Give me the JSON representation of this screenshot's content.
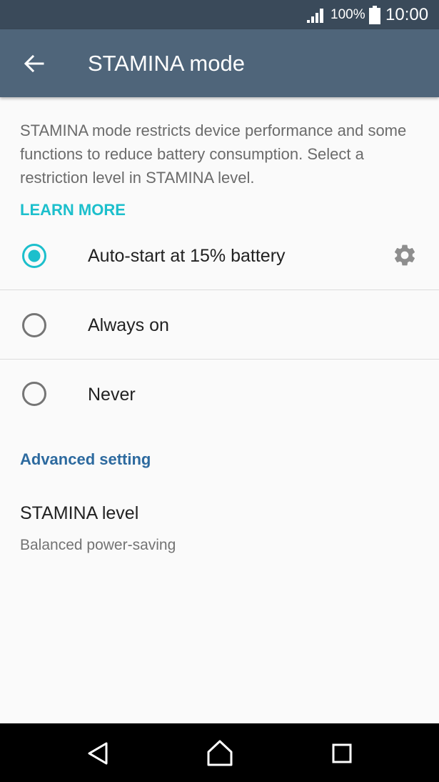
{
  "status_bar": {
    "battery_percent": "100%",
    "time": "10:00",
    "icons": [
      "signal-icon",
      "battery-icon"
    ]
  },
  "app_bar": {
    "title": "STAMINA mode",
    "back_icon": "arrow-back-icon"
  },
  "description": "STAMINA mode restricts device performance and some functions to reduce battery consumption. Select a restriction level in STAMINA level.",
  "learn_more": "LEARN MORE",
  "options": [
    {
      "label": "Auto-start at 15% battery",
      "selected": true,
      "has_settings": true
    },
    {
      "label": "Always on",
      "selected": false
    },
    {
      "label": "Never",
      "selected": false
    }
  ],
  "advanced": {
    "header": "Advanced setting",
    "stamina_level": {
      "title": "STAMINA level",
      "value": "Balanced power-saving"
    }
  },
  "nav_bar": {
    "buttons": [
      "back-nav-icon",
      "home-nav-icon",
      "recents-nav-icon"
    ]
  },
  "colors": {
    "status_bar": "#3a4a5a",
    "app_bar": "#4f657a",
    "accent": "#1cbfcc",
    "section_header": "#2d6a9f",
    "background": "#fafafa"
  }
}
